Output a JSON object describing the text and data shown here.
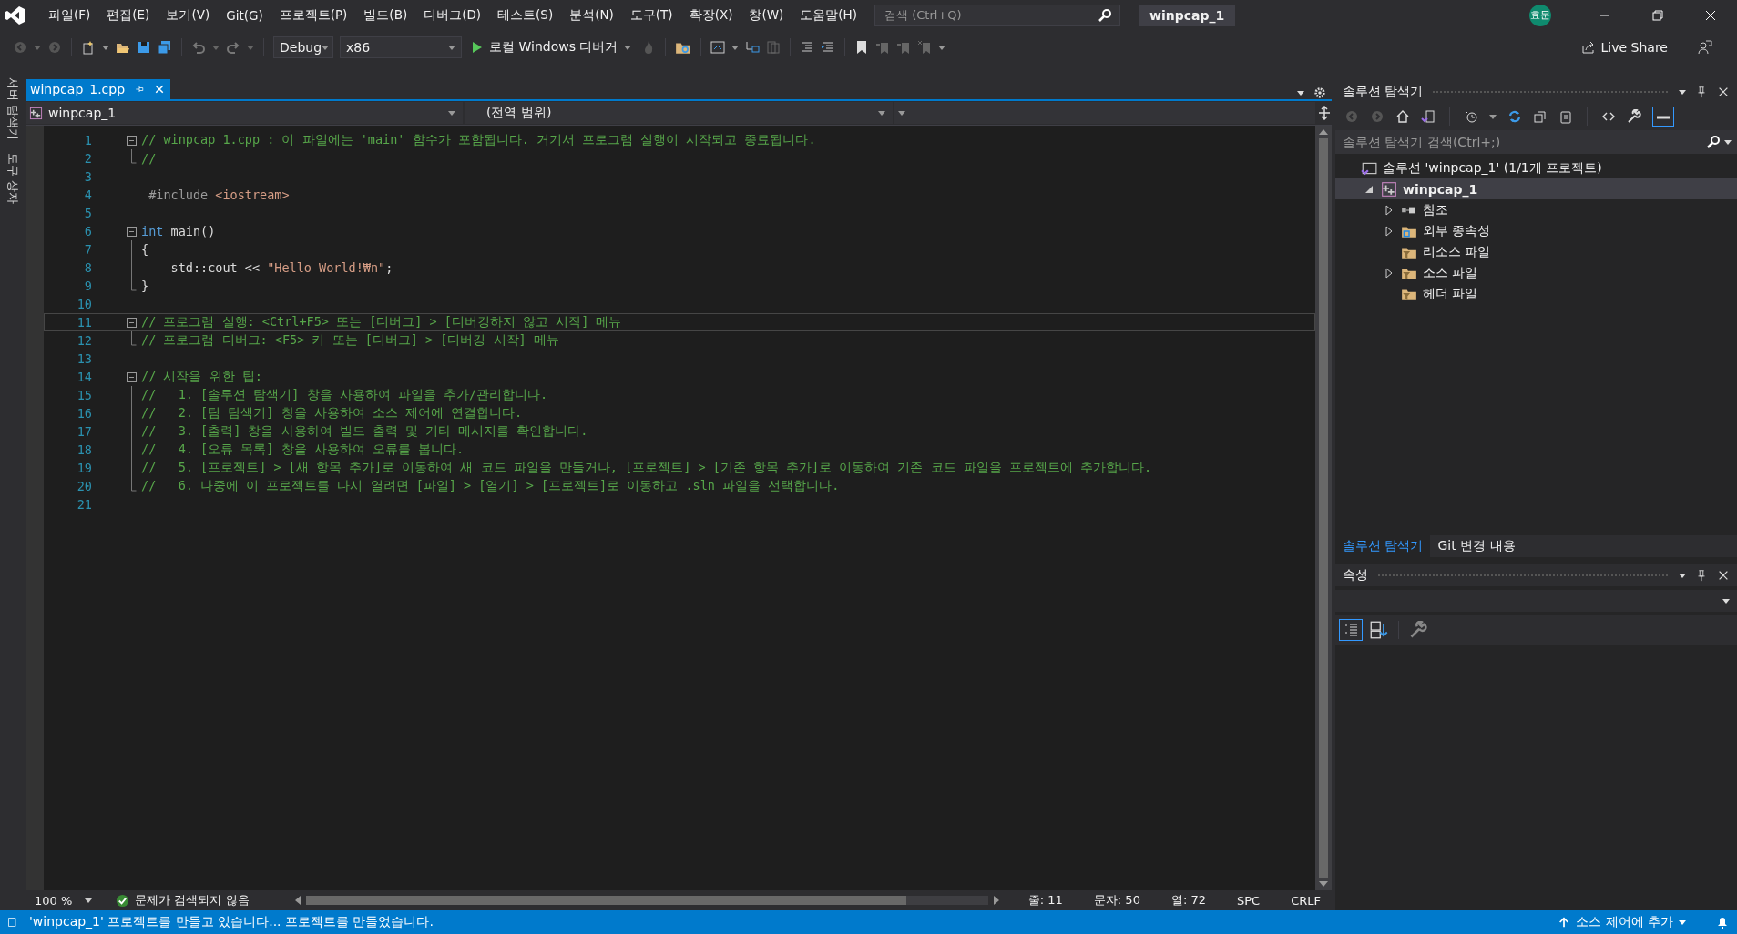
{
  "title_bar": {
    "menu": [
      "파일(F)",
      "편집(E)",
      "보기(V)",
      "Git(G)",
      "프로젝트(P)",
      "빌드(B)",
      "디버그(D)",
      "테스트(S)",
      "분석(N)",
      "도구(T)",
      "확장(X)",
      "창(W)",
      "도움말(H)"
    ],
    "search": {
      "placeholder": "검색 (Ctrl+Q)"
    },
    "solution_name": "winpcap_1",
    "avatar": "효문"
  },
  "toolbar": {
    "configuration": "Debug",
    "platform": "x86",
    "run_label": "로컬 Windows 디버거",
    "live_share": "Live Share"
  },
  "side_tabs": [
    "서버 탐색기",
    "도구 상자"
  ],
  "editor": {
    "tabs": [
      {
        "label": "winpcap_1.cpp",
        "selected": true
      }
    ],
    "nav": {
      "project": "winpcap_1",
      "scope": "(전역 범위)"
    },
    "lines": [
      {
        "number": "1",
        "kind": "start",
        "current": false,
        "tokens": [
          {
            "kind": "comment",
            "text": "// winpcap_1.cpp : 이 파일에는 'main' 함수가 포함됩니다. 거기서 프로그램 실행이 시작되고 종료됩니다."
          }
        ]
      },
      {
        "number": "2",
        "kind": "end",
        "current": false,
        "tokens": [
          {
            "kind": "comment",
            "text": "//"
          }
        ]
      },
      {
        "number": "3",
        "kind": "plain",
        "current": false
      },
      {
        "number": "4",
        "kind": "plain",
        "current": false,
        "tokens": [
          {
            "kind": "preprocessor",
            "text": " #include "
          },
          {
            "kind": "include",
            "text": "<iostream>"
          }
        ]
      },
      {
        "number": "5",
        "kind": "plain",
        "current": false
      },
      {
        "number": "6",
        "kind": "start",
        "current": false,
        "tokens": [
          {
            "kind": "keyword",
            "text": "int"
          },
          {
            "kind": "plain",
            "text": " main()"
          }
        ]
      },
      {
        "number": "7",
        "kind": "inner",
        "current": false,
        "tokens": [
          {
            "kind": "plain",
            "text": "{"
          }
        ]
      },
      {
        "number": "8",
        "kind": "inner",
        "current": false,
        "tokens": [
          {
            "kind": "plain",
            "text": "    std::cout << "
          },
          {
            "kind": "string",
            "text": "\"Hello World!₩n\""
          },
          {
            "kind": "plain",
            "text": ";"
          }
        ]
      },
      {
        "number": "9",
        "kind": "end",
        "current": false,
        "tokens": [
          {
            "kind": "plain",
            "text": "}"
          }
        ]
      },
      {
        "number": "10",
        "kind": "plain",
        "current": false
      },
      {
        "number": "11",
        "kind": "start",
        "current": true,
        "tokens": [
          {
            "kind": "comment",
            "text": "// 프로그램 실행: <Ctrl+F5> 또는 [디버그] > [디버깅하지 않고 시작] 메뉴"
          }
        ]
      },
      {
        "number": "12",
        "kind": "end",
        "current": false,
        "tokens": [
          {
            "kind": "comment",
            "text": "// 프로그램 디버그: <F5> 키 또는 [디버그] > [디버깅 시작] 메뉴"
          }
        ]
      },
      {
        "number": "13",
        "kind": "plain",
        "current": false
      },
      {
        "number": "14",
        "kind": "start",
        "current": false,
        "tokens": [
          {
            "kind": "comment",
            "text": "// 시작을 위한 팁: "
          }
        ]
      },
      {
        "number": "15",
        "kind": "inner",
        "current": false,
        "tokens": [
          {
            "kind": "comment",
            "text": "//   1. [솔루션 탐색기] 창을 사용하여 파일을 추가/관리합니다."
          }
        ]
      },
      {
        "number": "16",
        "kind": "inner",
        "current": false,
        "tokens": [
          {
            "kind": "comment",
            "text": "//   2. [팀 탐색기] 창을 사용하여 소스 제어에 연결합니다."
          }
        ]
      },
      {
        "number": "17",
        "kind": "inner",
        "current": false,
        "tokens": [
          {
            "kind": "comment",
            "text": "//   3. [출력] 창을 사용하여 빌드 출력 및 기타 메시지를 확인합니다."
          }
        ]
      },
      {
        "number": "18",
        "kind": "inner",
        "current": false,
        "tokens": [
          {
            "kind": "comment",
            "text": "//   4. [오류 목록] 창을 사용하여 오류를 봅니다."
          }
        ]
      },
      {
        "number": "19",
        "kind": "inner",
        "current": false,
        "tokens": [
          {
            "kind": "comment",
            "text": "//   5. [프로젝트] > [새 항목 추가]로 이동하여 새 코드 파일을 만들거나, [프로젝트] > [기존 항목 추가]로 이동하여 기존 코드 파일을 프로젝트에 추가합니다."
          }
        ]
      },
      {
        "number": "20",
        "kind": "end",
        "current": false,
        "tokens": [
          {
            "kind": "comment",
            "text": "//   6. 나중에 이 프로젝트를 다시 열려면 [파일] > [열기] > [프로젝트]로 이동하고 .sln 파일을 선택합니다."
          }
        ]
      },
      {
        "number": "21",
        "kind": "plain",
        "current": false
      }
    ],
    "zoom": "100 %",
    "issues": "문제가 검색되지 않음",
    "position": [
      {
        "label": "줄: 11"
      },
      {
        "label": "문자: 50"
      },
      {
        "label": "열: 72"
      },
      {
        "label": "SPC"
      },
      {
        "label": "CRLF"
      }
    ]
  },
  "solution_explorer": {
    "title": "솔루션 탐색기",
    "search": {
      "placeholder": "솔루션 탐색기 검색(Ctrl+;)"
    },
    "tree": [
      {
        "label": "솔루션 'winpcap_1' (1/1개 프로젝트)",
        "kind": "solution",
        "expandable": false,
        "selected": false,
        "children": [
          {
            "label": "winpcap_1",
            "kind": "project",
            "expandable": true,
            "expanded": true,
            "selected": true,
            "children": [
              {
                "label": "참조",
                "kind": "references",
                "expandable": true,
                "expanded": false,
                "selected": false
              },
              {
                "label": "외부 종속성",
                "kind": "external",
                "expandable": true,
                "expanded": false,
                "selected": false
              },
              {
                "label": "리소스 파일",
                "kind": "filter",
                "expandable": false,
                "selected": false
              },
              {
                "label": "소스 파일",
                "kind": "filter",
                "expandable": true,
                "expanded": false,
                "selected": false
              },
              {
                "label": "헤더 파일",
                "kind": "filter",
                "expandable": false,
                "selected": false
              }
            ]
          }
        ]
      }
    ],
    "tabs": [
      {
        "label": "솔루션 탐색기",
        "selected": true
      },
      {
        "label": "Git 변경 내용",
        "selected": false
      }
    ]
  },
  "properties": {
    "title": "속성"
  },
  "status_bar": {
    "message": "'winpcap_1' 프로젝트를 만들고 있습니다... 프로젝트를 만들었습니다.",
    "source_control": "소스 제어에 추가"
  }
}
